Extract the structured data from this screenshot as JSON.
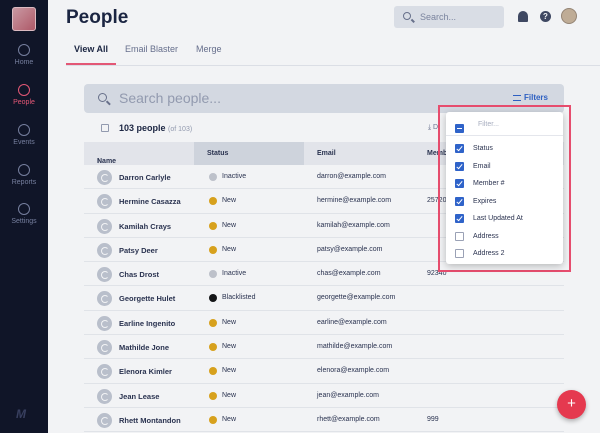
{
  "sidebar": {
    "items": [
      {
        "label": "Home",
        "icon": "home-icon",
        "active": false
      },
      {
        "label": "People",
        "icon": "person-icon",
        "active": true
      },
      {
        "label": "Events",
        "icon": "events-icon",
        "active": false
      },
      {
        "label": "Reports",
        "icon": "reports-icon",
        "active": false
      },
      {
        "label": "Settings",
        "icon": "gear-icon",
        "active": false
      }
    ],
    "brand_mark": "M"
  },
  "header": {
    "title": "People",
    "search_placeholder": "Search..."
  },
  "tabs": [
    {
      "label": "View All",
      "active": true
    },
    {
      "label": "Email Blaster",
      "active": false
    },
    {
      "label": "Merge",
      "active": false
    }
  ],
  "search": {
    "placeholder": "Search people...",
    "filters_label": "Filters"
  },
  "count": {
    "label": "103 people",
    "sub": "(of 103)",
    "download": "D"
  },
  "table": {
    "columns": [
      "Name",
      "Status",
      "Email",
      "Memb"
    ],
    "rows": [
      {
        "name": "Darron Carlyle",
        "status": "Inactive",
        "status_color": "#c7cad2",
        "email": "darron@example.com",
        "member": ""
      },
      {
        "name": "Hermine Casazza",
        "status": "New",
        "status_color": "#e3a81a",
        "email": "hermine@example.com",
        "member": "25720"
      },
      {
        "name": "Kamilah Crays",
        "status": "New",
        "status_color": "#e3a81a",
        "email": "kamilah@example.com",
        "member": ""
      },
      {
        "name": "Patsy Deer",
        "status": "New",
        "status_color": "#e3a81a",
        "email": "patsy@example.com",
        "member": ""
      },
      {
        "name": "Chas Drost",
        "status": "Inactive",
        "status_color": "#c7cad2",
        "email": "chas@example.com",
        "member": "92340"
      },
      {
        "name": "Georgette Hulet",
        "status": "Blacklisted",
        "status_color": "#141414",
        "email": "georgette@example.com",
        "member": ""
      },
      {
        "name": "Earline Ingenito",
        "status": "New",
        "status_color": "#e3a81a",
        "email": "earline@example.com",
        "member": ""
      },
      {
        "name": "Mathilde Jone",
        "status": "New",
        "status_color": "#e3a81a",
        "email": "mathilde@example.com",
        "member": ""
      },
      {
        "name": "Elenora Kimler",
        "status": "New",
        "status_color": "#e3a81a",
        "email": "elenora@example.com",
        "member": ""
      },
      {
        "name": "Jean Lease",
        "status": "New",
        "status_color": "#e3a81a",
        "email": "jean@example.com",
        "member": ""
      },
      {
        "name": "Rhett Montandon",
        "status": "New",
        "status_color": "#e3a81a",
        "email": "rhett@example.com",
        "member": "999"
      }
    ]
  },
  "filter_dropdown": {
    "placeholder": "Filter...",
    "items": [
      {
        "label": "Status",
        "checked": true
      },
      {
        "label": "Email",
        "checked": true
      },
      {
        "label": "Member #",
        "checked": true
      },
      {
        "label": "Expires",
        "checked": true
      },
      {
        "label": "Last Updated At",
        "checked": true
      },
      {
        "label": "Address",
        "checked": false
      },
      {
        "label": "Address 2",
        "checked": false
      }
    ]
  },
  "fab_label": "+",
  "colors": {
    "accent": "#f05a78",
    "primary": "#2f63c9",
    "sidebar_bg": "#0f1426",
    "highlight": "#e74d6e"
  }
}
